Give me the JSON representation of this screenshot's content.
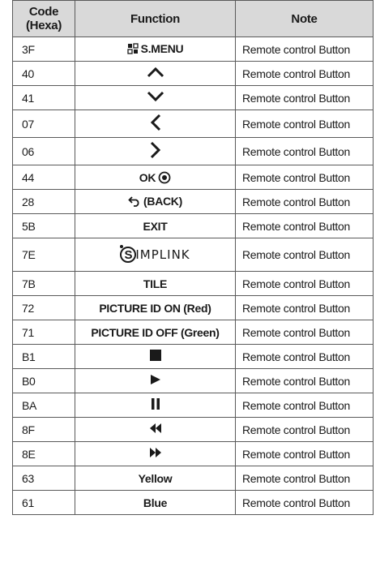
{
  "headers": {
    "code": "Code\n(Hexa)",
    "code_line1": "Code",
    "code_line2": "(Hexa)",
    "function": "Function",
    "note": "Note"
  },
  "rows": [
    {
      "code": "3F",
      "function": "S.MENU",
      "icon": "smenu-icon",
      "note": "Remote control Button"
    },
    {
      "code": "40",
      "function": "",
      "icon": "chevron-up-icon",
      "note": "Remote control Button"
    },
    {
      "code": "41",
      "function": "",
      "icon": "chevron-down-icon",
      "note": "Remote control Button"
    },
    {
      "code": "07",
      "function": "",
      "icon": "chevron-left-icon",
      "note": "Remote control Button"
    },
    {
      "code": "06",
      "function": "",
      "icon": "chevron-right-icon",
      "note": "Remote control Button"
    },
    {
      "code": "44",
      "function": "OK",
      "icon": "ok-target-icon",
      "note": "Remote control Button"
    },
    {
      "code": "28",
      "function": "(BACK)",
      "icon": "back-arrow-icon",
      "note": "Remote control Button"
    },
    {
      "code": "5B",
      "function": "EXIT",
      "icon": "",
      "note": "Remote control Button"
    },
    {
      "code": "7E",
      "function": "SIMPLINK",
      "icon": "simplink-logo",
      "note": "Remote control Button"
    },
    {
      "code": "7B",
      "function": "TILE",
      "icon": "",
      "note": "Remote control Button"
    },
    {
      "code": "72",
      "function": "PICTURE ID ON (Red)",
      "icon": "",
      "note": "Remote control Button"
    },
    {
      "code": "71",
      "function": "PICTURE ID OFF (Green)",
      "icon": "",
      "note": "Remote control Button"
    },
    {
      "code": "B1",
      "function": "",
      "icon": "stop-icon",
      "note": "Remote control Button"
    },
    {
      "code": "B0",
      "function": "",
      "icon": "play-icon",
      "note": "Remote control Button"
    },
    {
      "code": "BA",
      "function": "",
      "icon": "pause-icon",
      "note": "Remote control Button"
    },
    {
      "code": "8F",
      "function": "",
      "icon": "rewind-icon",
      "note": "Remote control Button"
    },
    {
      "code": "8E",
      "function": "",
      "icon": "fast-forward-icon",
      "note": "Remote control Button"
    },
    {
      "code": "63",
      "function": "Yellow",
      "icon": "",
      "note": "Remote control Button"
    },
    {
      "code": "61",
      "function": "Blue",
      "icon": "",
      "note": "Remote control Button"
    }
  ],
  "colors": {
    "header_bg": "#d9d9d9",
    "border": "#5a5a5a",
    "text": "#1a1a1a"
  }
}
